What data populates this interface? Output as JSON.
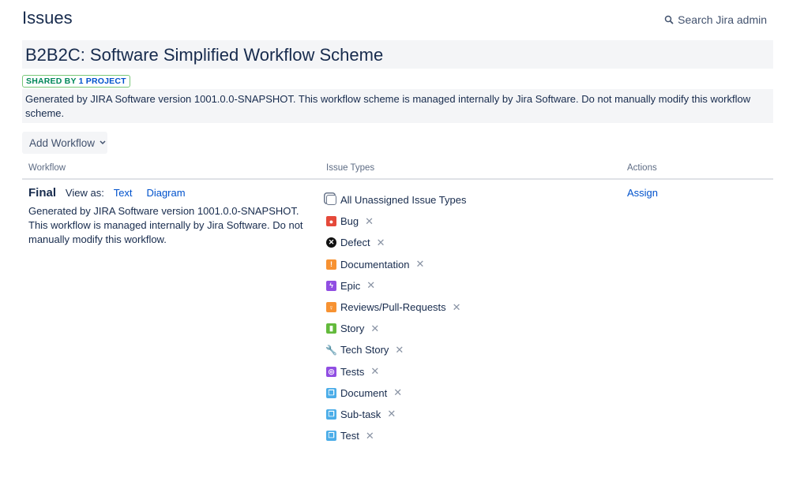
{
  "page": {
    "title": "Issues",
    "search_label": "Search Jira admin"
  },
  "scheme": {
    "title": "B2B2C: Software Simplified Workflow Scheme",
    "badge_prefix": "SHARED BY",
    "badge_count": "1 PROJECT",
    "description": "Generated by JIRA Software version 1001.0.0-SNAPSHOT. This workflow scheme is managed internally by Jira Software. Do not manually modify this workflow scheme."
  },
  "toolbar": {
    "add_workflow": "Add Workflow"
  },
  "table": {
    "headers": [
      "Workflow",
      "Issue Types",
      "Actions"
    ]
  },
  "workflow": {
    "name": "Final",
    "view_as": "View as:",
    "text_link": "Text",
    "diagram_link": "Diagram",
    "description": "Generated by JIRA Software version 1001.0.0-SNAPSHOT. This workflow is managed internally by Jira Software. Do not manually modify this workflow.",
    "action": "Assign",
    "issue_types": [
      {
        "label": "All Unassigned Issue Types",
        "icon": "stack-icon",
        "color": "#ffffff",
        "glyph": "",
        "removable": false
      },
      {
        "label": "Bug",
        "icon": "bug-icon",
        "color": "#e5493a",
        "glyph": "●",
        "removable": true
      },
      {
        "label": "Defect",
        "icon": "defect-icon",
        "color": "#111111",
        "glyph": "✕",
        "removable": true
      },
      {
        "label": "Documentation",
        "icon": "documentation-icon",
        "color": "#f79232",
        "glyph": "!",
        "removable": true
      },
      {
        "label": "Epic",
        "icon": "epic-icon",
        "color": "#904ee2",
        "glyph": "ϟ",
        "removable": true
      },
      {
        "label": "Reviews/Pull-Requests",
        "icon": "lightbulb-icon",
        "color": "#f79232",
        "glyph": "♀",
        "removable": true
      },
      {
        "label": "Story",
        "icon": "story-icon",
        "color": "#63ba3c",
        "glyph": "▮",
        "removable": true
      },
      {
        "label": "Tech Story",
        "icon": "tools-icon",
        "color": "#ffffff",
        "glyph": "🔧",
        "removable": true
      },
      {
        "label": "Tests",
        "icon": "tests-icon",
        "color": "#904ee2",
        "glyph": "◎",
        "removable": true
      },
      {
        "label": "Document",
        "icon": "subtask-icon",
        "color": "#4bade8",
        "glyph": "❐",
        "removable": true
      },
      {
        "label": "Sub-task",
        "icon": "subtask-icon",
        "color": "#4bade8",
        "glyph": "❐",
        "removable": true
      },
      {
        "label": "Test",
        "icon": "subtask-icon",
        "color": "#4bade8",
        "glyph": "❐",
        "removable": true
      }
    ]
  }
}
